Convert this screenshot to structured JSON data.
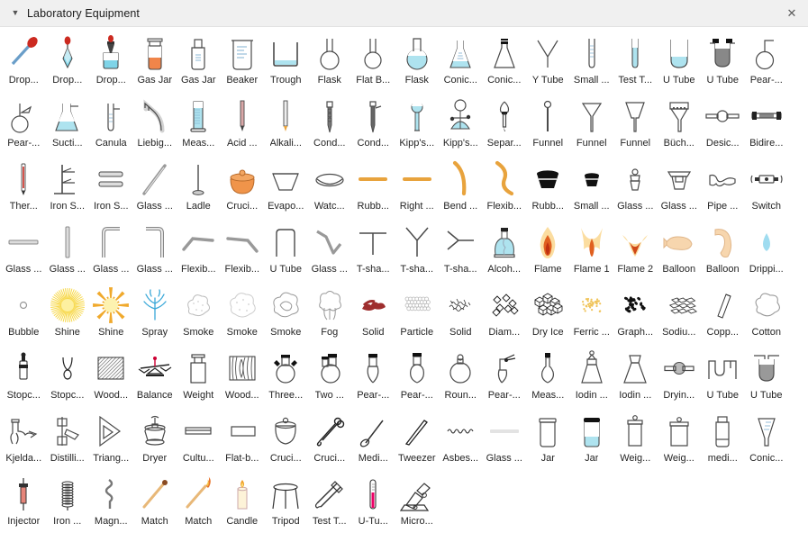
{
  "window": {
    "title": "Laboratory Equipment",
    "collapse_icon": "caret-down-icon",
    "close_icon": "close-icon",
    "close_label": "✕",
    "caret_label": "▼",
    "titlebar_bg": "#f0f0f0",
    "accent_blue": "#8fd8e8",
    "accent_orange": "#e8a33d",
    "accent_red": "#cc2a20",
    "outline": "#4a4a4a"
  },
  "stencil": {
    "columns": 18,
    "items": [
      {
        "label": "Drop...",
        "icon": "dropper-slanted-icon"
      },
      {
        "label": "Drop...",
        "icon": "dropper-bulb-icon"
      },
      {
        "label": "Drop...",
        "icon": "dropper-bottle-icon"
      },
      {
        "label": "Gas Jar",
        "icon": "gas-jar-filled-icon"
      },
      {
        "label": "Gas Jar",
        "icon": "gas-jar-empty-icon"
      },
      {
        "label": "Beaker",
        "icon": "beaker-icon"
      },
      {
        "label": "Trough",
        "icon": "trough-icon"
      },
      {
        "label": "Flask",
        "icon": "round-bottom-flask-icon"
      },
      {
        "label": "Flat B...",
        "icon": "flat-bottom-flask-icon"
      },
      {
        "label": "Flask",
        "icon": "flask-filled-icon"
      },
      {
        "label": "Conic...",
        "icon": "conical-flask-graduated-icon"
      },
      {
        "label": "Conic...",
        "icon": "conical-flask-stopper-icon"
      },
      {
        "label": "Y Tube",
        "icon": "y-tube-icon"
      },
      {
        "label": "Small ...",
        "icon": "small-test-tube-icon"
      },
      {
        "label": "Test T...",
        "icon": "test-tube-filled-icon"
      },
      {
        "label": "U Tube",
        "icon": "u-tube-filled-icon"
      },
      {
        "label": "U Tube",
        "icon": "u-tube-packed-icon"
      },
      {
        "label": "Pear-...",
        "icon": "pear-flask-sidearm-icon"
      },
      {
        "label": "Pear-...",
        "icon": "pear-flask-branch-icon"
      },
      {
        "label": "Sucti...",
        "icon": "suction-flask-icon"
      },
      {
        "label": "Canula",
        "icon": "canula-icon"
      },
      {
        "label": "Liebig...",
        "icon": "liebig-tube-icon"
      },
      {
        "label": "Meas...",
        "icon": "measuring-cylinder-icon"
      },
      {
        "label": "Acid ...",
        "icon": "acid-burette-icon"
      },
      {
        "label": "Alkali...",
        "icon": "alkali-burette-icon"
      },
      {
        "label": "Cond...",
        "icon": "condenser-icon"
      },
      {
        "label": "Cond...",
        "icon": "condenser-2-icon"
      },
      {
        "label": "Kipp's...",
        "icon": "kipps-apparatus-icon"
      },
      {
        "label": "Kipp's...",
        "icon": "kipps-apparatus-2-icon"
      },
      {
        "label": "Separ...",
        "icon": "separating-funnel-icon"
      },
      {
        "label": "Funnel",
        "icon": "funnel-thin-icon"
      },
      {
        "label": "Funnel",
        "icon": "funnel-cone-icon"
      },
      {
        "label": "Funnel",
        "icon": "funnel-wide-icon"
      },
      {
        "label": "Büch...",
        "icon": "buchner-funnel-icon"
      },
      {
        "label": "Desic...",
        "icon": "desiccator-tube-icon"
      },
      {
        "label": "Bidire...",
        "icon": "bidirectional-tube-icon"
      },
      {
        "label": "Ther...",
        "icon": "thermometer-icon"
      },
      {
        "label": "Iron S...",
        "icon": "iron-stand-icon"
      },
      {
        "label": "Iron S...",
        "icon": "iron-shelf-icon"
      },
      {
        "label": "Glass ...",
        "icon": "glass-rod-diagonal-icon"
      },
      {
        "label": "Ladle",
        "icon": "ladle-icon"
      },
      {
        "label": "Cruci...",
        "icon": "crucible-orange-icon"
      },
      {
        "label": "Evapo...",
        "icon": "evaporating-dish-icon"
      },
      {
        "label": "Watc...",
        "icon": "watch-glass-icon"
      },
      {
        "label": "Rubb...",
        "icon": "rubber-tube-straight-icon"
      },
      {
        "label": "Right ...",
        "icon": "right-tube-icon"
      },
      {
        "label": "Bend ...",
        "icon": "bend-tube-icon"
      },
      {
        "label": "Flexib...",
        "icon": "flexible-tube-s-icon"
      },
      {
        "label": "Rubb...",
        "icon": "rubber-stopper-large-icon"
      },
      {
        "label": "Small ...",
        "icon": "rubber-stopper-small-icon"
      },
      {
        "label": "Glass ...",
        "icon": "glass-stopper-small-icon"
      },
      {
        "label": "Glass ...",
        "icon": "glass-stopper-large-icon"
      },
      {
        "label": "Pipe ...",
        "icon": "pipe-clamp-icon"
      },
      {
        "label": "Switch",
        "icon": "switch-icon"
      },
      {
        "label": "Glass ...",
        "icon": "glass-tube-horizontal-icon"
      },
      {
        "label": "Glass ...",
        "icon": "glass-tube-vertical-icon"
      },
      {
        "label": "Glass ...",
        "icon": "glass-tube-elbow-left-icon"
      },
      {
        "label": "Glass ...",
        "icon": "glass-tube-elbow-right-icon"
      },
      {
        "label": "Flexib...",
        "icon": "flexible-tube-bend-up-icon"
      },
      {
        "label": "Flexib...",
        "icon": "flexible-tube-bend-down-icon"
      },
      {
        "label": "U Tube",
        "icon": "u-tube-inverted-icon"
      },
      {
        "label": "Glass ...",
        "icon": "glass-tube-zigzag-icon"
      },
      {
        "label": "T-sha...",
        "icon": "t-shape-tube-icon"
      },
      {
        "label": "T-sha...",
        "icon": "t-shape-tube-y-icon"
      },
      {
        "label": "T-sha...",
        "icon": "t-shape-tube-side-icon"
      },
      {
        "label": "Alcoh...",
        "icon": "alcohol-lamp-icon"
      },
      {
        "label": "Flame",
        "icon": "flame-icon"
      },
      {
        "label": "Flame 1",
        "icon": "flame-1-icon"
      },
      {
        "label": "Flame 2",
        "icon": "flame-2-icon"
      },
      {
        "label": "Balloon",
        "icon": "balloon-icon"
      },
      {
        "label": "Balloon",
        "icon": "balloon-bent-icon"
      },
      {
        "label": "Drippi...",
        "icon": "dripping-water-icon"
      },
      {
        "label": "Bubble",
        "icon": "bubble-icon"
      },
      {
        "label": "Shine",
        "icon": "shine-icon"
      },
      {
        "label": "Shine",
        "icon": "shine-star-icon"
      },
      {
        "label": "Spray",
        "icon": "spray-icon"
      },
      {
        "label": "Smoke",
        "icon": "smoke-icon"
      },
      {
        "label": "Smoke",
        "icon": "smoke-2-icon"
      },
      {
        "label": "Smoke",
        "icon": "smoke-3-icon"
      },
      {
        "label": "Fog",
        "icon": "fog-icon"
      },
      {
        "label": "Solid",
        "icon": "solid-red-icon"
      },
      {
        "label": "Particle",
        "icon": "particle-icon"
      },
      {
        "label": "Solid",
        "icon": "solid-scribble-icon"
      },
      {
        "label": "Diam...",
        "icon": "diamond-chunks-icon"
      },
      {
        "label": "Dry Ice",
        "icon": "dry-ice-icon"
      },
      {
        "label": "Ferric ...",
        "icon": "ferric-powder-icon"
      },
      {
        "label": "Graph...",
        "icon": "graphite-icon"
      },
      {
        "label": "Sodiu...",
        "icon": "sodium-flakes-icon"
      },
      {
        "label": "Copp...",
        "icon": "copper-strip-icon"
      },
      {
        "label": "Cotton",
        "icon": "cotton-icon"
      },
      {
        "label": "Stopc...",
        "icon": "stopcock-icon"
      },
      {
        "label": "Stopc...",
        "icon": "stopcock-2-icon"
      },
      {
        "label": "Wood...",
        "icon": "wood-block-hatched-icon"
      },
      {
        "label": "Balance",
        "icon": "balance-icon"
      },
      {
        "label": "Weight",
        "icon": "weight-icon"
      },
      {
        "label": "Wood...",
        "icon": "wood-grain-icon"
      },
      {
        "label": "Three...",
        "icon": "three-neck-flask-icon"
      },
      {
        "label": "Two ...",
        "icon": "two-neck-flask-icon"
      },
      {
        "label": "Pear-...",
        "icon": "pear-flask-pointed-icon"
      },
      {
        "label": "Pear-...",
        "icon": "pear-flask-round-icon"
      },
      {
        "label": "Roun...",
        "icon": "round-flask-icon"
      },
      {
        "label": "Pear-...",
        "icon": "pear-flask-arm-icon"
      },
      {
        "label": "Meas...",
        "icon": "measuring-flask-icon"
      },
      {
        "label": "Iodin ...",
        "icon": "iodine-flask-icon"
      },
      {
        "label": "Iodin ...",
        "icon": "iodine-flask-2-icon"
      },
      {
        "label": "Dryin...",
        "icon": "drying-tube-icon"
      },
      {
        "label": "U Tube",
        "icon": "u-tube-double-icon"
      },
      {
        "label": "U Tube",
        "icon": "u-tube-packed-2-icon"
      },
      {
        "label": "Kjelda...",
        "icon": "kjeldahl-flask-icon"
      },
      {
        "label": "Distilli...",
        "icon": "distilling-head-icon"
      },
      {
        "label": "Triang...",
        "icon": "triangle-funnel-icon"
      },
      {
        "label": "Dryer",
        "icon": "dryer-icon"
      },
      {
        "label": "Cultu...",
        "icon": "culture-dish-icon"
      },
      {
        "label": "Flat-b...",
        "icon": "flat-bottom-dish-icon"
      },
      {
        "label": "Cruci...",
        "icon": "crucible-lid-icon"
      },
      {
        "label": "Cruci...",
        "icon": "crucible-tongs-icon"
      },
      {
        "label": "Medi...",
        "icon": "medicine-spoon-icon"
      },
      {
        "label": "Tweezer",
        "icon": "tweezer-icon"
      },
      {
        "label": "Asbes...",
        "icon": "asbestos-net-icon"
      },
      {
        "label": "Glass ...",
        "icon": "glass-plate-icon"
      },
      {
        "label": "Jar",
        "icon": "jar-empty-icon"
      },
      {
        "label": "Jar",
        "icon": "jar-filled-icon"
      },
      {
        "label": "Weig...",
        "icon": "weighing-bottle-tall-icon"
      },
      {
        "label": "Weig...",
        "icon": "weighing-bottle-wide-icon"
      },
      {
        "label": "medi...",
        "icon": "medicine-bottle-icon"
      },
      {
        "label": "Conic...",
        "icon": "conical-measure-icon"
      },
      {
        "label": "Injector",
        "icon": "injector-icon"
      },
      {
        "label": "Iron ...",
        "icon": "iron-spring-icon"
      },
      {
        "label": "Magn...",
        "icon": "magnesium-ribbon-icon"
      },
      {
        "label": "Match",
        "icon": "match-icon"
      },
      {
        "label": "Match",
        "icon": "match-lit-icon"
      },
      {
        "label": "Candle",
        "icon": "candle-icon"
      },
      {
        "label": "Tripod",
        "icon": "tripod-icon"
      },
      {
        "label": "Test T...",
        "icon": "test-tube-holder-icon"
      },
      {
        "label": "U-Tu...",
        "icon": "u-tube-thermo-icon"
      },
      {
        "label": "Micro...",
        "icon": "microscope-icon"
      }
    ]
  }
}
